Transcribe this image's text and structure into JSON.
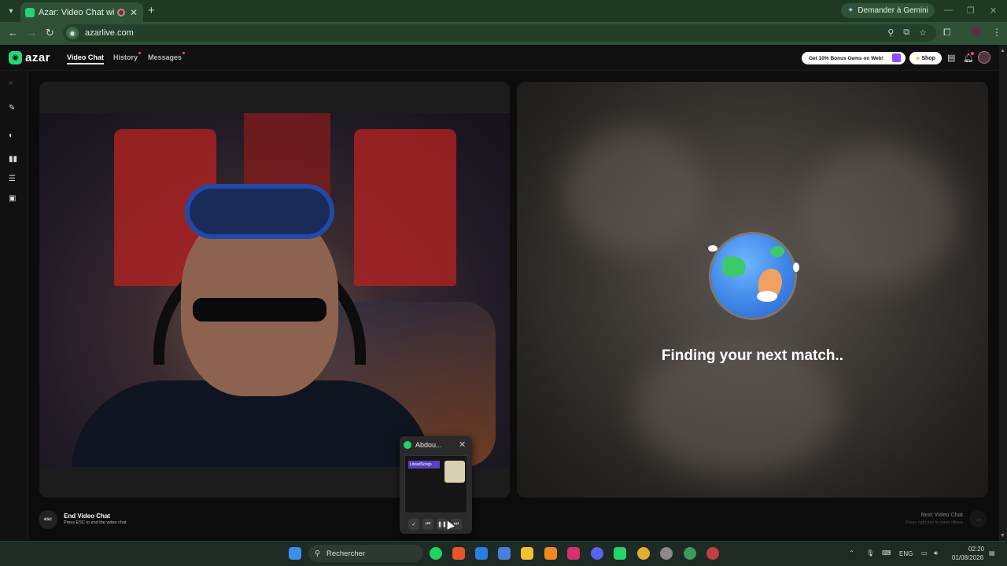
{
  "browser": {
    "tab_title": "Azar: Video Chat with New",
    "new_tab_label": "+",
    "url": "azarlive.com",
    "gemini_label": "Demander à Gemini"
  },
  "app": {
    "logo_text": "azar",
    "nav": [
      {
        "label": "Video Chat",
        "active": true
      },
      {
        "label": "History",
        "active": false
      },
      {
        "label": "Messages",
        "active": false
      }
    ],
    "promo_label": "Get 10% Bonus Gems on Web!",
    "shop_label": "Shop"
  },
  "match": {
    "status_text": "Finding your next match.."
  },
  "footer": {
    "esc_label": "esc",
    "end_title": "End Video Chat",
    "end_sub": "Press ESC to end the video chat",
    "next_title": "Next Video Chat",
    "next_sub": "Press right key to meet others"
  },
  "spotify": {
    "title": "Abdou...",
    "thumb_banner": "LiteadSongs"
  },
  "taskbar": {
    "search_placeholder": "Rechercher",
    "lang": "ENG",
    "time": "02:20",
    "date": "01/08/2026"
  },
  "colors": {
    "accent": "#25d97a",
    "browser_frame": "#1e3a22",
    "spotify_green": "#1ed760"
  }
}
